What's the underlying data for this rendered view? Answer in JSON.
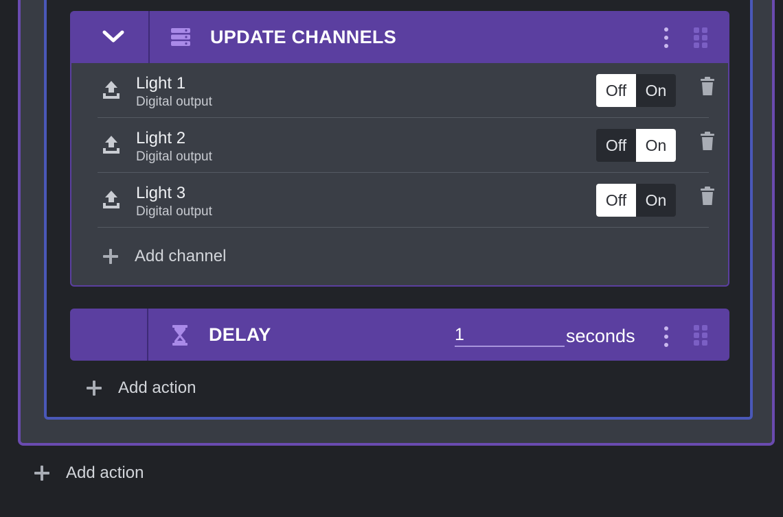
{
  "update_card": {
    "title": "UPDATE CHANNELS",
    "channels": [
      {
        "name": "Light 1",
        "type": "Digital output",
        "off_label": "Off",
        "on_label": "On",
        "state": "Off"
      },
      {
        "name": "Light 2",
        "type": "Digital output",
        "off_label": "Off",
        "on_label": "On",
        "state": "On"
      },
      {
        "name": "Light 3",
        "type": "Digital output",
        "off_label": "Off",
        "on_label": "On",
        "state": "Off"
      }
    ],
    "add_channel_label": "Add channel"
  },
  "delay_card": {
    "title": "DELAY",
    "value": "1",
    "unit": "seconds"
  },
  "inner_add_action_label": "Add action",
  "outer_add_action_label": "Add action",
  "colors": {
    "accent_purple": "#5b3fa0",
    "inner_border_blue": "#4a58b8",
    "icon_purple": "#a98ae8"
  },
  "icons": {
    "collapse": "chevron-down-icon",
    "update_channels": "server-stack-icon",
    "channel": "upload-tray-icon",
    "delete": "trash-icon",
    "delay": "hourglass-icon",
    "menu": "kebab-menu-icon",
    "drag": "drag-grip-icon",
    "add": "plus-icon"
  }
}
